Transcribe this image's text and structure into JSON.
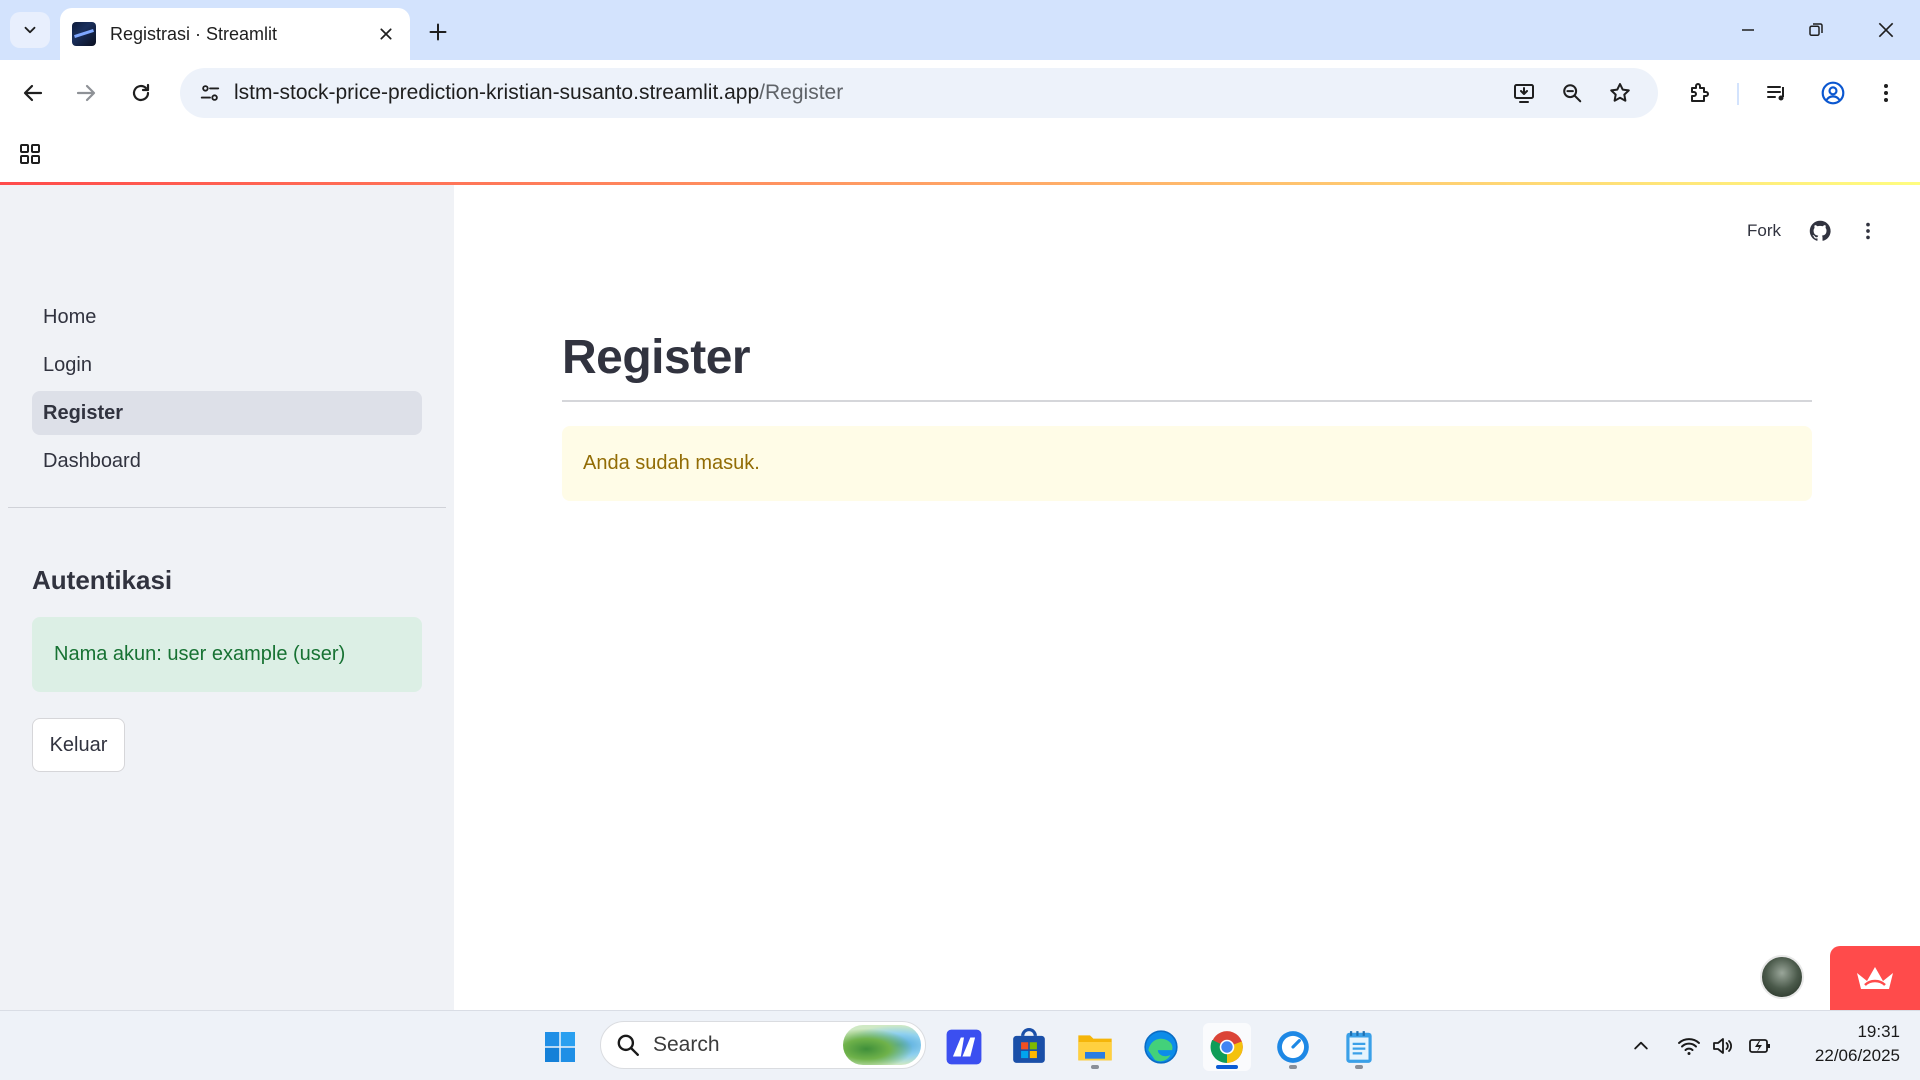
{
  "browser": {
    "tab_title": "Registrasi · Streamlit",
    "url_host": "lstm-stock-price-prediction-kristian-susanto.streamlit.app",
    "url_path": "/Register"
  },
  "app": {
    "header": {
      "fork_label": "Fork"
    },
    "sidebar": {
      "nav_items": [
        {
          "label": "Home",
          "active": false
        },
        {
          "label": "Login",
          "active": false
        },
        {
          "label": "Register",
          "active": true
        },
        {
          "label": "Dashboard",
          "active": false
        }
      ],
      "section_header": "Autentikasi",
      "account_message": "Nama akun: user example (user)",
      "logout_label": "Keluar"
    },
    "main": {
      "title": "Register",
      "warning_message": "Anda sudah masuk."
    }
  },
  "taskbar": {
    "search_label": "Search",
    "time": "19:31",
    "date": "22/06/2025"
  },
  "colors": {
    "accent_red": "#ff4b4b",
    "tab_strip": "#d3e3fd",
    "sidebar_bg": "#f0f2f6",
    "success_bg": "#dcefe5",
    "success_text": "#177233",
    "warning_bg": "#fffce7",
    "warning_text": "#926c05"
  },
  "icons": [
    "tab-search-icon",
    "close-icon",
    "plus-icon",
    "minimize-icon",
    "restore-icon",
    "back-arrow-icon",
    "forward-arrow-icon",
    "reload-icon",
    "site-info-icon",
    "install-app-icon",
    "zoom-icon",
    "star-icon",
    "extensions-icon",
    "media-icon",
    "profile-icon",
    "more-vert-icon",
    "apps-grid-icon",
    "github-icon",
    "streamlit-crown-icon",
    "windows-start-icon",
    "search-icon",
    "wifi-icon",
    "volume-icon",
    "battery-icon",
    "chevron-up-icon"
  ]
}
